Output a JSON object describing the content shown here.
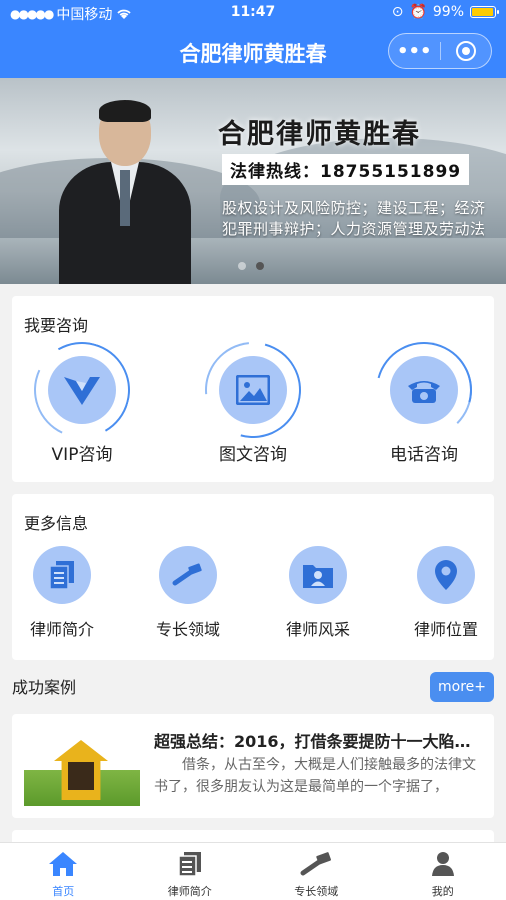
{
  "status": {
    "carrier": "中国移动",
    "time": "11:47",
    "battery": "99%",
    "battery_level": 0.99
  },
  "nav": {
    "title": "合肥律师黄胜春",
    "more_icon": "more-dots-icon",
    "close_icon": "target-icon"
  },
  "banner": {
    "title": "合肥律师黄胜春",
    "hotline": "法律热线：18755151899",
    "desc": "股权设计及风险防控；建设工程；经济犯罪刑事辩护；人力资源管理及劳动法",
    "slide_count": 2,
    "active_slide": 2
  },
  "consult": {
    "title": "我要咨询",
    "items": [
      {
        "label": "VIP咨询",
        "icon": "vip-icon"
      },
      {
        "label": "图文咨询",
        "icon": "image-icon"
      },
      {
        "label": "电话咨询",
        "icon": "phone-icon"
      }
    ]
  },
  "more": {
    "title": "更多信息",
    "items": [
      {
        "label": "律师简介",
        "icon": "document-icon"
      },
      {
        "label": "专长领域",
        "icon": "gavel-icon"
      },
      {
        "label": "律师风采",
        "icon": "folder-person-icon"
      },
      {
        "label": "律师位置",
        "icon": "location-pin-icon"
      }
    ]
  },
  "cases": {
    "title": "成功案例",
    "more_label": "more+",
    "items": [
      {
        "title": "超强总结：2016，打借条要提防十一大陷阱…",
        "summary": "借条，从古至今，大概是人们接触最多的法律文书了，很多朋友认为这是最简单的一个字据了，"
      }
    ]
  },
  "tabbar": {
    "items": [
      {
        "label": "首页",
        "icon": "home-icon",
        "active": true
      },
      {
        "label": "律师简介",
        "icon": "document-icon",
        "active": false
      },
      {
        "label": "专长领域",
        "icon": "gavel-icon",
        "active": false
      },
      {
        "label": "我的",
        "icon": "user-icon",
        "active": false
      }
    ]
  },
  "colors": {
    "primary": "#3a86ff",
    "accent": "#4a8ef0",
    "icon_bg": "#a9c6f7"
  }
}
